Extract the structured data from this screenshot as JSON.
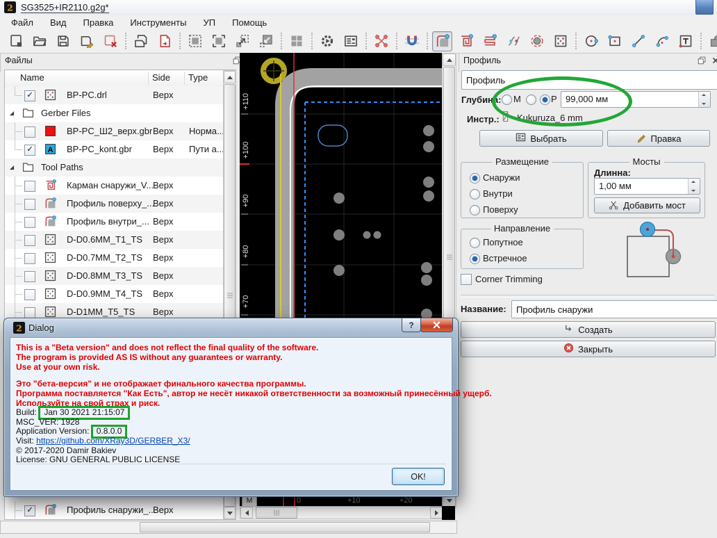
{
  "window": {
    "title": "SG3525+IR2110.g2g*",
    "logo_glyph": "2",
    "menu": [
      "Файл",
      "Вид",
      "Правка",
      "Инструменты",
      "УП",
      "Помощь"
    ]
  },
  "toolbar": {
    "groups": [
      [
        "new-file",
        "open-file",
        "save",
        "save-as",
        "close-file"
      ],
      [
        "save-all",
        "export-doc"
      ],
      [
        "zoom-fit",
        "zoom-selected",
        "zoom-out-selected",
        "zoom-in-selected"
      ],
      [
        "zoom-100"
      ],
      [
        "settings-gear",
        "properties-form"
      ],
      [
        "transform-points"
      ],
      [
        "snap-magnet"
      ],
      [
        "profile-tool",
        "pocket-tool",
        "raster-tool",
        "zigzag-tool",
        "marker-tool",
        "drill-tool"
      ],
      [
        "draw-circle",
        "draw-rect",
        "draw-line",
        "draw-arc",
        "draw-text"
      ],
      [
        "shape-union",
        "shape-mask"
      ]
    ],
    "selected": "profile-tool",
    "overflow": "»"
  },
  "files_panel": {
    "title": "Файлы",
    "columns": [
      "Name",
      "Side",
      "Type"
    ],
    "rows": [
      {
        "level": 2,
        "check": "on",
        "icon": "file-drill",
        "name": "BP-PC.drl",
        "side": "Верх",
        "type": "",
        "last": true
      },
      {
        "level": 1,
        "expander": true,
        "icon": "folder",
        "name": "Gerber Files",
        "side": "",
        "type": ""
      },
      {
        "level": 2,
        "check": "off",
        "icon": "red-layer",
        "name": "BP-PC_Ш2_верх.gbr",
        "side": "Верх",
        "type": "Норма..."
      },
      {
        "level": 2,
        "check": "on",
        "icon": "aperture-a",
        "name": "BP-PC_kont.gbr",
        "side": "Верх",
        "type": "Пути а...",
        "last": true
      },
      {
        "level": 1,
        "expander": true,
        "icon": "folder",
        "name": "Tool Paths",
        "side": "",
        "type": ""
      },
      {
        "level": 2,
        "check": "off",
        "icon": "pocket-tool",
        "name": "Карман снаружи_V...",
        "side": "Верх",
        "type": ""
      },
      {
        "level": 2,
        "check": "off",
        "icon": "profile-tool",
        "name": "Профиль поверху_...",
        "side": "Верх",
        "type": ""
      },
      {
        "level": 2,
        "check": "off",
        "icon": "profile-tool",
        "name": "Профиль внутри_...",
        "side": "Верх",
        "type": ""
      },
      {
        "level": 2,
        "check": "off",
        "icon": "file-drill",
        "name": "D-D0.6MM_T1_TS",
        "side": "Верх",
        "type": ""
      },
      {
        "level": 2,
        "check": "off",
        "icon": "file-drill",
        "name": "D-D0.7MM_T2_TS",
        "side": "Верх",
        "type": ""
      },
      {
        "level": 2,
        "check": "off",
        "icon": "file-drill",
        "name": "D-D0.8MM_T3_TS",
        "side": "Верх",
        "type": ""
      },
      {
        "level": 2,
        "check": "off",
        "icon": "file-drill",
        "name": "D-D0.9MM_T4_TS",
        "side": "Верх",
        "type": ""
      },
      {
        "level": 2,
        "check": "off",
        "icon": "file-drill",
        "name": "D-D1MM_T5_TS",
        "side": "Верх",
        "type": ""
      }
    ],
    "bottom_row": {
      "level": 2,
      "check": "on",
      "icon": "profile-tool",
      "name": "Профиль снаружи_...",
      "side": "Верх",
      "type": ""
    }
  },
  "view": {
    "y_labels": [
      "+110",
      "+100",
      "+90",
      "+80",
      "+70"
    ],
    "x_labels": [
      "0",
      "+10",
      "+20"
    ],
    "m_button": "M"
  },
  "profile_panel": {
    "title": "Профиль",
    "name_value": "Профиль",
    "depth_label": "Глубина:",
    "depth_options": {
      "m": "М",
      "p": "P"
    },
    "depth_value": "99,000 мм",
    "tool_label": "Инстр.:",
    "tool_name": "Kukuruza_6 mm",
    "select_button": "Выбрать",
    "edit_button": "Правка",
    "placement_group": {
      "title": "Размещение",
      "options": [
        "Снаружи",
        "Внутри",
        "Поверху"
      ],
      "selected": "Снаружи"
    },
    "bridges_group": {
      "title": "Мосты",
      "length_label": "Длинна:",
      "length_value": "1,00 мм",
      "add_button": "Добавить мост"
    },
    "direction_group": {
      "title": "Направление",
      "options": [
        "Попутное",
        "Встречное"
      ],
      "selected": "Встречное"
    },
    "corner_trimming_label": "Corner Trimming",
    "name_label": "Название:",
    "profile_name_value": "Профиль снаружи",
    "create_button": "Создать",
    "close_button": "Закрыть"
  },
  "dialog": {
    "title": "Dialog",
    "help_glyph": "?",
    "warning_en": [
      "This is a \"Beta version\" and does not reflect the final quality of the software.",
      "The program is provided AS IS without any guarantees or warranty.",
      "Use at your own risk."
    ],
    "warning_ru": [
      "Это \"бета-версия\" и не отображает финального качества программы.",
      "Программа поставляется \"Как Есть\", автор не несёт никакой ответственности за возможный принесённый ущерб.",
      "Используйте на свой страх и риск."
    ],
    "build_label": "Build:",
    "build_value": "Jan 30 2021 21:15:07",
    "msc_ver": "MSC_VER: 1928",
    "appver_label": "Application Version:",
    "appver_value": "0.8.0.0",
    "visit_label": "Visit:",
    "visit_url": "https://github.com/XRay3D/GERBER_X3/",
    "copyright": "© 2017-2020 Damir Bakiev",
    "license": "License: GNU GENERAL PUBLIC LICENSE",
    "ok_button": "OK!"
  },
  "colors": {
    "annotation_green": "#1da32e",
    "warning_red": "#e00000",
    "link_blue": "#0645ad",
    "canvas_bg": "#000000"
  }
}
